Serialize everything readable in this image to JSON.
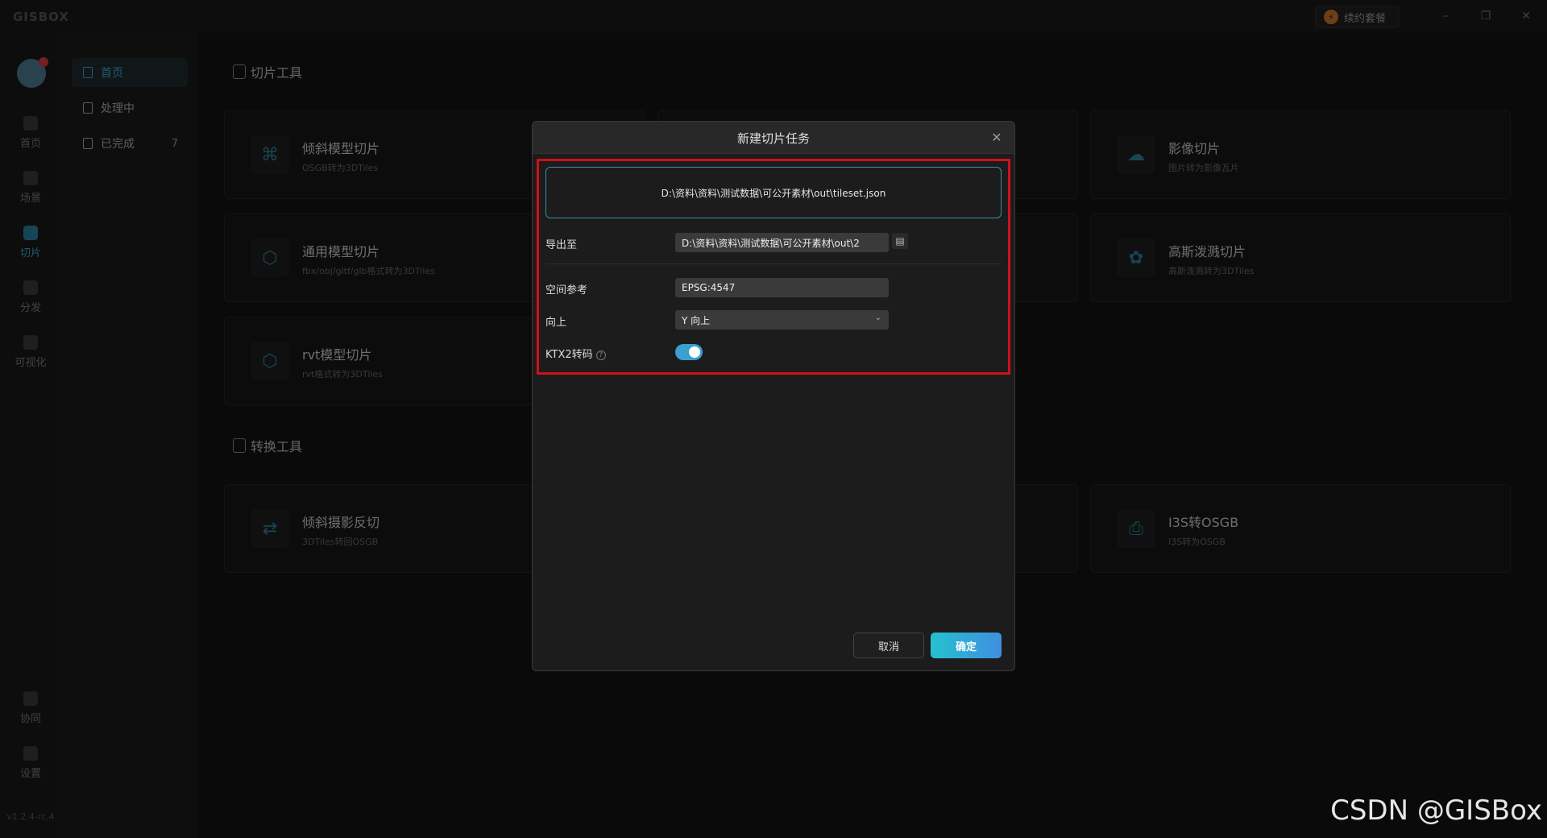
{
  "app": {
    "logo": "GISBOX",
    "plan_button": "续约套餐",
    "version": "v1.2.4-rc.4"
  },
  "rail": {
    "items": [
      {
        "label": "首页",
        "icon": "home-icon"
      },
      {
        "label": "场景",
        "icon": "scene-icon"
      },
      {
        "label": "切片",
        "icon": "slice-icon",
        "active": true
      },
      {
        "label": "分发",
        "icon": "distribute-icon"
      },
      {
        "label": "可视化",
        "icon": "visual-icon"
      }
    ],
    "bottom": [
      {
        "label": "协同",
        "icon": "collab-icon"
      },
      {
        "label": "设置",
        "icon": "settings-icon"
      }
    ]
  },
  "subnav": {
    "items": [
      {
        "label": "首页",
        "active": true
      },
      {
        "label": "处理中"
      },
      {
        "label": "已完成",
        "count": "7"
      }
    ]
  },
  "main": {
    "slice_title": "切片工具",
    "convert_title": "转换工具",
    "cards": [
      {
        "title": "倾斜模型切片",
        "sub": "OSGB转为3DTiles",
        "icon": "drone-icon"
      },
      {
        "title": "影像切片",
        "sub": "图片转为影像瓦片",
        "icon": "cloud-image-icon"
      },
      {
        "title": "通用模型切片",
        "sub": "fbx/obj/gltf/glb格式转为3DTiles",
        "icon": "cube-icon"
      },
      {
        "title": "高斯泼溅切片",
        "sub": "高斯泼溅转为3DTiles",
        "icon": "splat-icon"
      },
      {
        "title": "rvt模型切片",
        "sub": "rvt格式转为3DTiles",
        "icon": "cube-icon"
      },
      {
        "title": "倾斜摄影反切",
        "sub": "3DTiles转回OSGB",
        "icon": "reverse-icon"
      },
      {
        "title": "I3S转OSGB",
        "sub": "I3S转为OSGB",
        "icon": "package-icon"
      }
    ]
  },
  "dialog": {
    "title": "新建切片任务",
    "source_path": "D:\\资料\\资料\\测试数据\\可公开素材\\out\\tileset.json",
    "export_label": "导出至",
    "export_value": "D:\\资料\\资料\\测试数据\\可公开素材\\out\\2",
    "srs_label": "空间参考",
    "srs_value": "EPSG:4547",
    "up_label": "向上",
    "up_value": "Y 向上",
    "ktx_label": "KTX2转码",
    "ktx_enabled": true,
    "cancel": "取消",
    "ok": "确定"
  },
  "watermark": "CSDN @GISBox",
  "colors": {
    "accent": "#3aa5c8",
    "highlight_border": "#d0101a",
    "ok_gradient_start": "#25c1cf",
    "ok_gradient_end": "#3f8fe0"
  }
}
